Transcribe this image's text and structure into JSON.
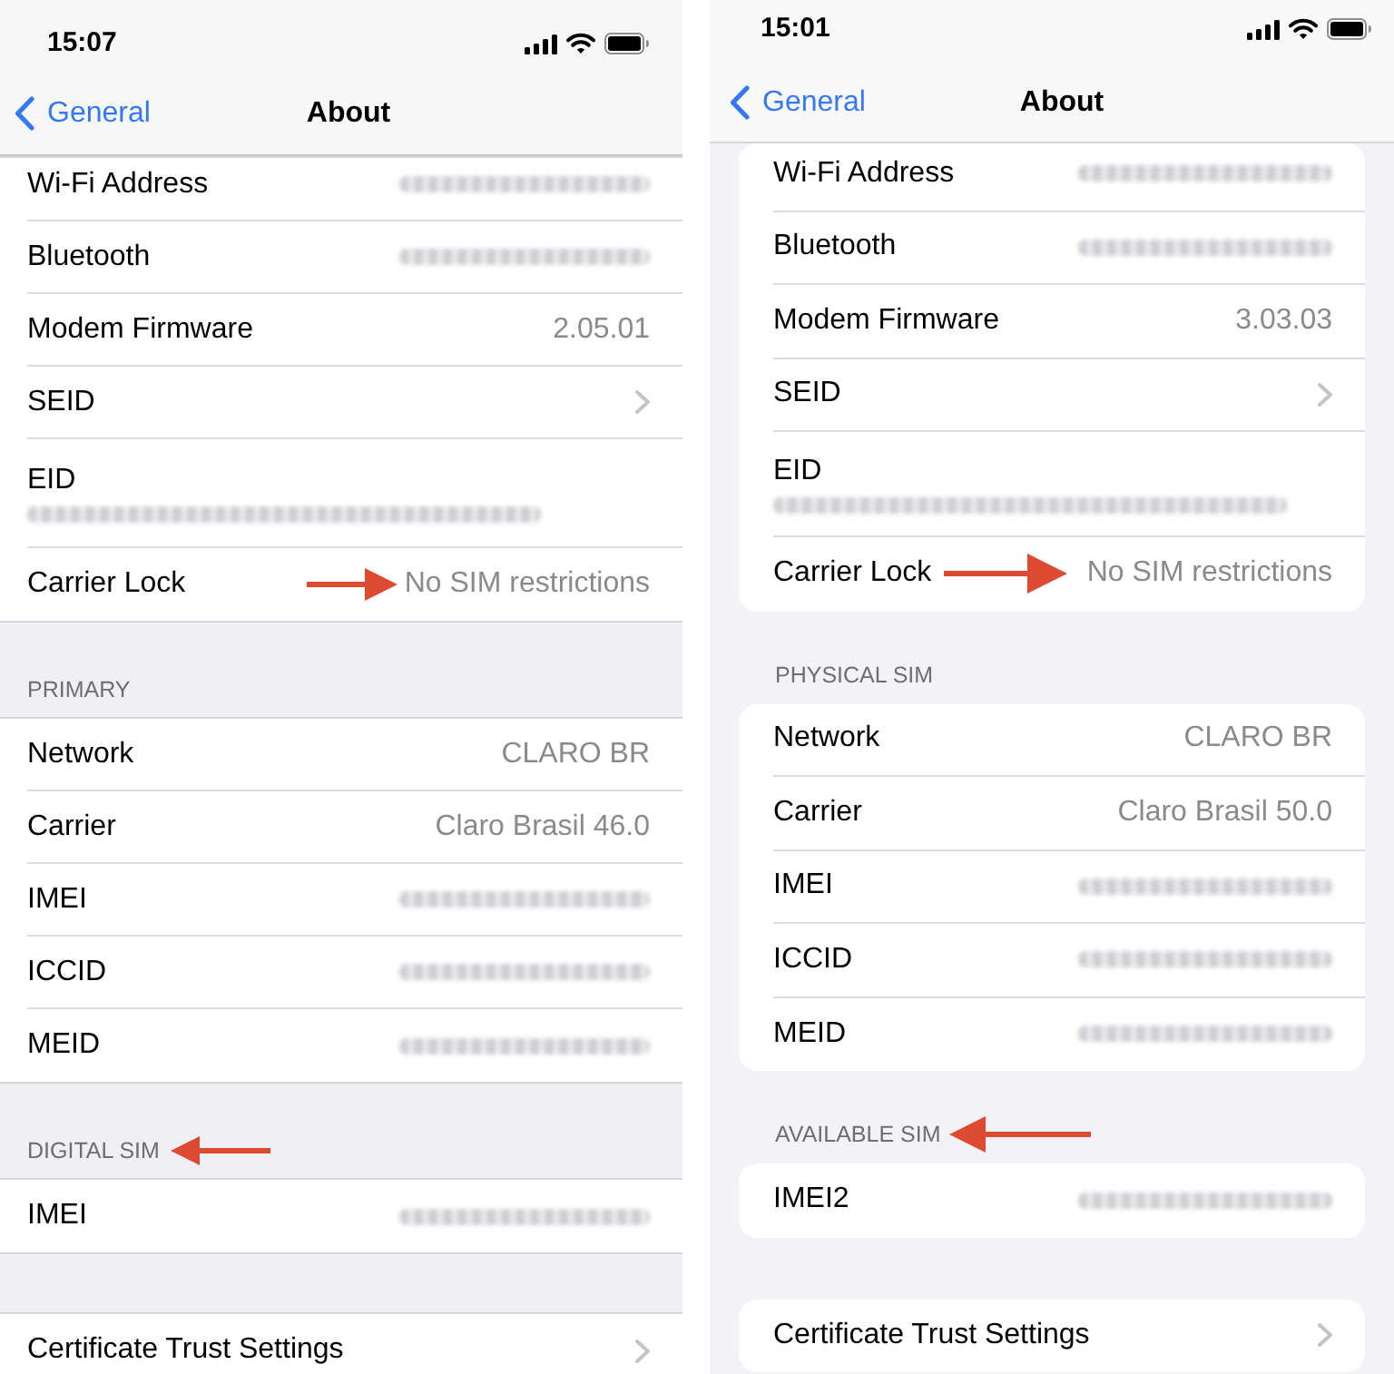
{
  "phones": [
    {
      "kind": "plain",
      "status_bar": {
        "time": "15:07"
      },
      "nav": {
        "back": "General",
        "title": "About"
      },
      "sections": [
        {
          "rows": [
            {
              "kind": "hidden",
              "label": "Wi-Fi Address"
            },
            {
              "kind": "hidden",
              "label": "Bluetooth"
            },
            {
              "kind": "detail",
              "label": "Modem Firmware",
              "value": "2.05.01"
            },
            {
              "kind": "disclosure",
              "label": "SEID"
            },
            {
              "kind": "stacked_hidden",
              "label": "EID"
            },
            {
              "kind": "detail",
              "label": "Carrier Lock",
              "value": "No SIM restrictions",
              "annotated": true
            }
          ]
        },
        {
          "header": "PRIMARY",
          "rows": [
            {
              "kind": "detail",
              "label": "Network",
              "value": "CLARO BR"
            },
            {
              "kind": "detail",
              "label": "Carrier",
              "value": "Claro Brasil 46.0"
            },
            {
              "kind": "hidden",
              "label": "IMEI"
            },
            {
              "kind": "hidden",
              "label": "ICCID"
            },
            {
              "kind": "hidden",
              "label": "MEID"
            }
          ]
        },
        {
          "header": "DIGITAL SIM",
          "annotated": true,
          "rows": [
            {
              "kind": "hidden",
              "label": "IMEI"
            }
          ]
        },
        {
          "rows": [
            {
              "kind": "disclosure",
              "label": "Certificate Trust Settings"
            }
          ]
        }
      ]
    },
    {
      "kind": "inset",
      "status_bar": {
        "time": "15:01"
      },
      "nav": {
        "back": "General",
        "title": "About"
      },
      "sections": [
        {
          "rows": [
            {
              "kind": "hidden",
              "label": "Wi-Fi Address"
            },
            {
              "kind": "hidden",
              "label": "Bluetooth"
            },
            {
              "kind": "detail",
              "label": "Modem Firmware",
              "value": "3.03.03"
            },
            {
              "kind": "disclosure",
              "label": "SEID"
            },
            {
              "kind": "stacked_hidden",
              "label": "EID"
            },
            {
              "kind": "detail",
              "label": "Carrier Lock",
              "value": "No SIM restrictions",
              "annotated": true
            }
          ]
        },
        {
          "header": "PHYSICAL SIM",
          "rows": [
            {
              "kind": "detail",
              "label": "Network",
              "value": "CLARO BR"
            },
            {
              "kind": "detail",
              "label": "Carrier",
              "value": "Claro Brasil 50.0"
            },
            {
              "kind": "hidden",
              "label": "IMEI"
            },
            {
              "kind": "hidden",
              "label": "ICCID"
            },
            {
              "kind": "hidden",
              "label": "MEID"
            }
          ]
        },
        {
          "header": "AVAILABLE SIM",
          "annotated": true,
          "rows": [
            {
              "kind": "hidden",
              "label": "IMEI2"
            }
          ]
        },
        {
          "rows": [
            {
              "kind": "disclosure",
              "label": "Certificate Trust Settings"
            }
          ]
        }
      ]
    }
  ]
}
